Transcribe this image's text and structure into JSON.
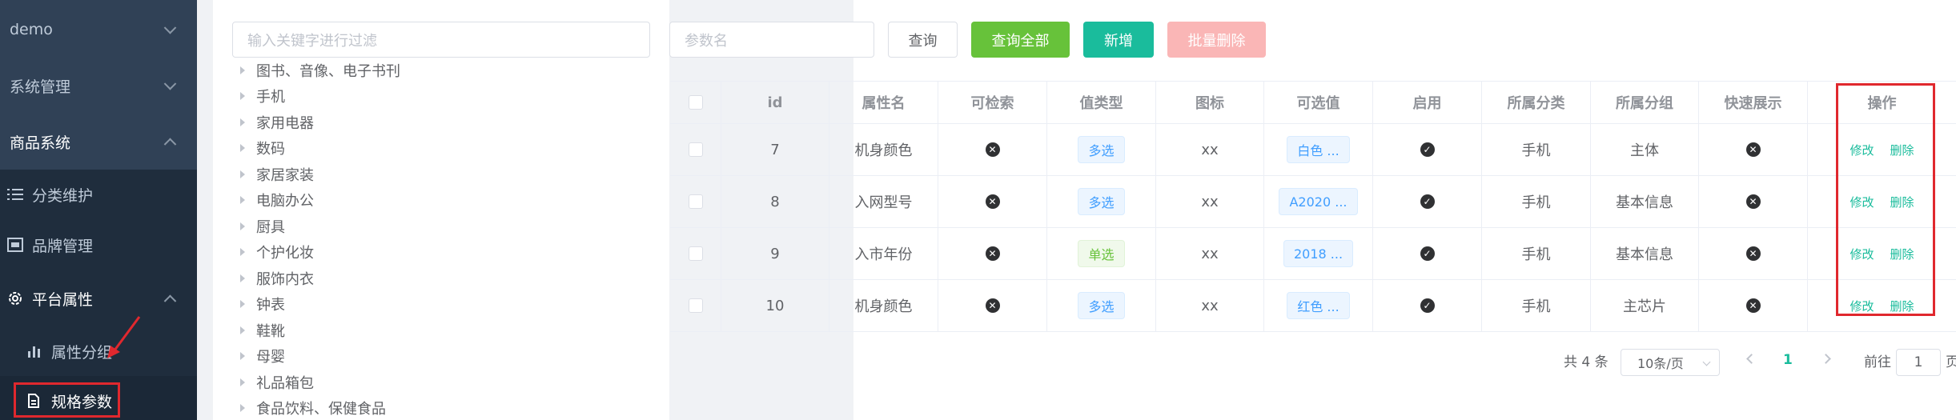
{
  "sidebar": {
    "items": [
      {
        "label": "demo"
      },
      {
        "label": "系统管理"
      },
      {
        "label": "商品系统"
      },
      {
        "label": "分类维护"
      },
      {
        "label": "品牌管理"
      },
      {
        "label": "平台属性"
      },
      {
        "label": "属性分组"
      },
      {
        "label": "规格参数"
      }
    ]
  },
  "tree": {
    "filter_placeholder": "输入关键字进行过滤",
    "nodes": [
      "图书、音像、电子书刊",
      "手机",
      "家用电器",
      "数码",
      "家居家装",
      "电脑办公",
      "厨具",
      "个护化妆",
      "服饰内衣",
      "钟表",
      "鞋靴",
      "母婴",
      "礼品箱包",
      "食品饮料、保健食品"
    ]
  },
  "toolbar": {
    "param_placeholder": "参数名",
    "query_label": "查询",
    "query_all_label": "查询全部",
    "add_label": "新增",
    "batch_delete_label": "批量删除"
  },
  "table": {
    "headers": [
      "id",
      "属性名",
      "可检索",
      "值类型",
      "图标",
      "可选值",
      "启用",
      "所属分类",
      "所属分组",
      "快速展示",
      "操作"
    ],
    "rows": [
      {
        "id": "7",
        "name": "机身颜色",
        "searchable": false,
        "value_type": "多选",
        "icon": "xx",
        "values": "白色 ...",
        "enabled": true,
        "category": "手机",
        "group": "主体",
        "quick_show": false
      },
      {
        "id": "8",
        "name": "入网型号",
        "searchable": false,
        "value_type": "多选",
        "icon": "xx",
        "values": "A2020 ...",
        "enabled": true,
        "category": "手机",
        "group": "基本信息",
        "quick_show": false
      },
      {
        "id": "9",
        "name": "入市年份",
        "searchable": false,
        "value_type": "单选",
        "icon": "xx",
        "values": "2018 ...",
        "enabled": true,
        "category": "手机",
        "group": "基本信息",
        "quick_show": false
      },
      {
        "id": "10",
        "name": "机身颜色",
        "searchable": false,
        "value_type": "多选",
        "icon": "xx",
        "values": "红色 ...",
        "enabled": true,
        "category": "手机",
        "group": "主芯片",
        "quick_show": false
      }
    ],
    "edit_label": "修改",
    "delete_label": "删除"
  },
  "pagination": {
    "total_text": "共 4 条",
    "page_size": "10条/页",
    "current_page": "1",
    "goto_label": "前往",
    "goto_value": "1",
    "page_suffix": "页"
  },
  "colors": {
    "sidebar_bg": "#304156",
    "accent": "#1abc9c",
    "annotation_red": "#e0282e"
  }
}
